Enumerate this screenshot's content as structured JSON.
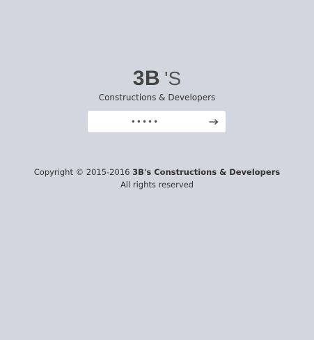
{
  "logo": {
    "main": "3B",
    "suffix": "'S"
  },
  "subtitle": "Constructions & Developers",
  "login": {
    "password_value": "•••••",
    "submit_icon": "arrow-right-icon"
  },
  "footer": {
    "copyright_prefix": "Copyright © 2015-2016 ",
    "company_name": "3B's Constructions & Developers",
    "rights": "All rights reserved"
  }
}
